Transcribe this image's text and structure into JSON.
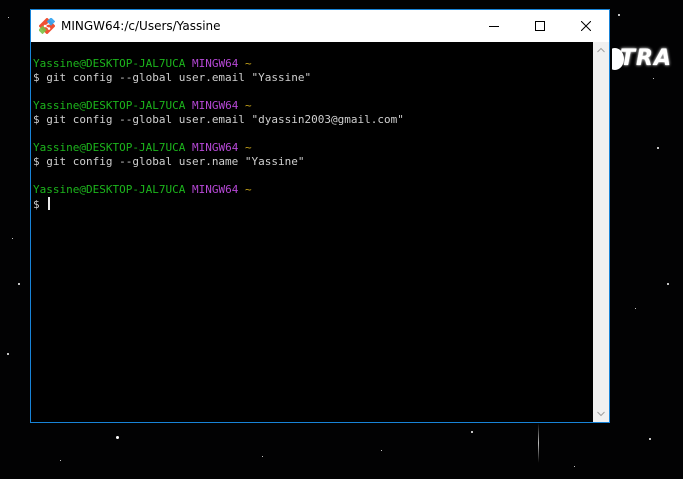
{
  "window": {
    "title": "MINGW64:/c/Users/Yassine",
    "accent_color": "#1883d7",
    "icons": {
      "app": "git-bash-icon",
      "minimize": "minimize-icon",
      "maximize": "maximize-icon",
      "close": "close-icon"
    }
  },
  "terminal": {
    "colors": {
      "user": "#1cb51c",
      "host": "#b648d6",
      "path": "#c8a51a",
      "text": "#cfcfcf"
    },
    "sessions": [
      {
        "user": "Yassine@DESKTOP-JAL7UCA",
        "host": "MINGW64",
        "path": "~",
        "prompt": "$",
        "command": "git config --global user.email \"Yassine\""
      },
      {
        "user": "Yassine@DESKTOP-JAL7UCA",
        "host": "MINGW64",
        "path": "~",
        "prompt": "$",
        "command": "git config --global user.email \"dyassin2003@gmail.com\""
      },
      {
        "user": "Yassine@DESKTOP-JAL7UCA",
        "host": "MINGW64",
        "path": "~",
        "prompt": "$",
        "command": "git config --global user.name \"Yassine\""
      },
      {
        "user": "Yassine@DESKTOP-JAL7UCA",
        "host": "MINGW64",
        "path": "~",
        "prompt": "$",
        "command": ""
      }
    ]
  },
  "wallpaper": {
    "logo_text": "TRA"
  }
}
